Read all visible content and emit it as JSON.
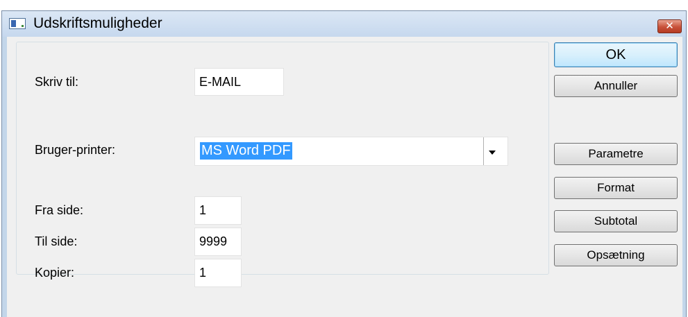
{
  "window": {
    "title": "Udskriftsmuligheder",
    "close_glyph": "✕",
    "icon": "app-window-icon"
  },
  "form": {
    "write_to_label": "Skriv til:",
    "write_to_value": "E-MAIL",
    "user_printer_label": "Bruger-printer:",
    "user_printer_value": "MS Word PDF",
    "from_page_label": "Fra side:",
    "from_page_value": "1",
    "to_page_label": "Til side:",
    "to_page_value": "9999",
    "copies_label": "Kopier:",
    "copies_value": "1"
  },
  "buttons": {
    "ok": "OK",
    "cancel": "Annuller",
    "parameters": "Parametre",
    "format": "Format",
    "subtotal": "Subtotal",
    "setup": "Opsætning"
  },
  "colors": {
    "selection": "#3399ff",
    "close_button": "#c8523a",
    "titlebar": "#c6d8ee",
    "default_button_border": "#3c7fb1"
  }
}
